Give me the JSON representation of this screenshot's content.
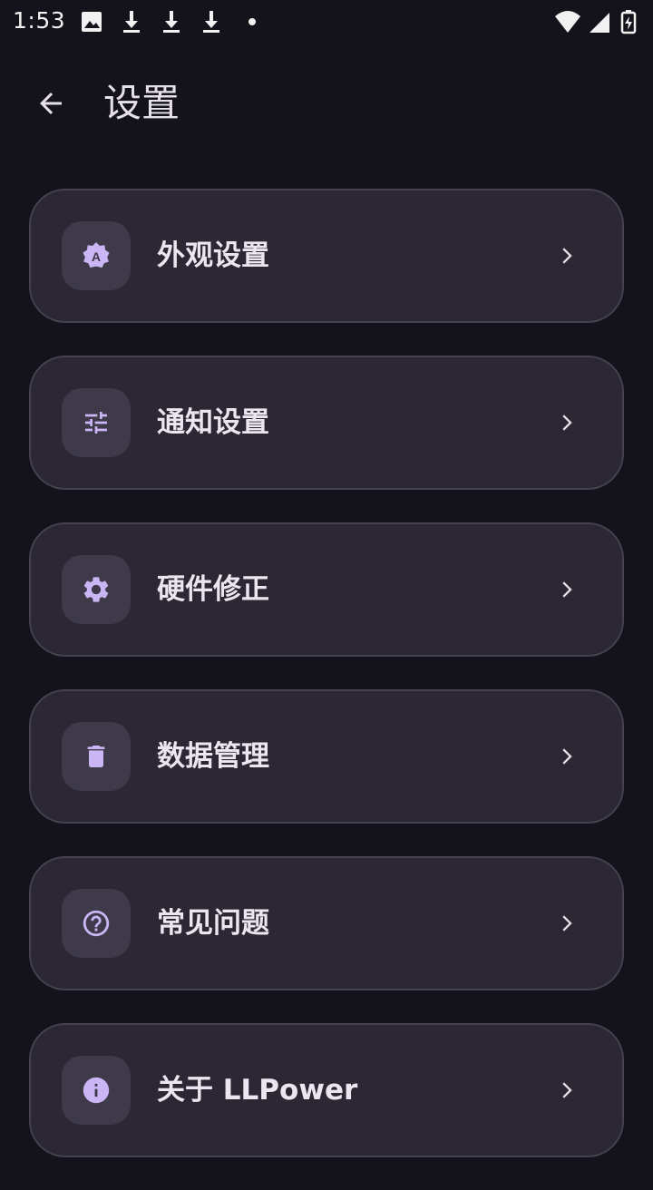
{
  "status_bar": {
    "time": "1:53",
    "left_icons": [
      "image-icon",
      "download-icon",
      "download-icon",
      "download-icon",
      "dot-icon"
    ],
    "right_icons": [
      "wifi-icon",
      "cellular-signal-icon",
      "battery-charging-icon"
    ]
  },
  "app_bar": {
    "title": "设置",
    "back_icon": "arrow-left-icon"
  },
  "settings_items": [
    {
      "label": "外观设置",
      "icon": "appearance-icon"
    },
    {
      "label": "通知设置",
      "icon": "tune-sliders-icon"
    },
    {
      "label": "硬件修正",
      "icon": "gear-icon"
    },
    {
      "label": "数据管理",
      "icon": "trash-icon"
    },
    {
      "label": "常见问题",
      "icon": "help-circle-icon"
    },
    {
      "label": "关于 LLPower",
      "icon": "info-icon"
    }
  ],
  "colors": {
    "background": "#14121b",
    "card": "#2b2833",
    "card_border": "#45414f",
    "icon_box": "#3e3a4a",
    "accent": "#cbb6f5",
    "text": "#ece6f0"
  }
}
